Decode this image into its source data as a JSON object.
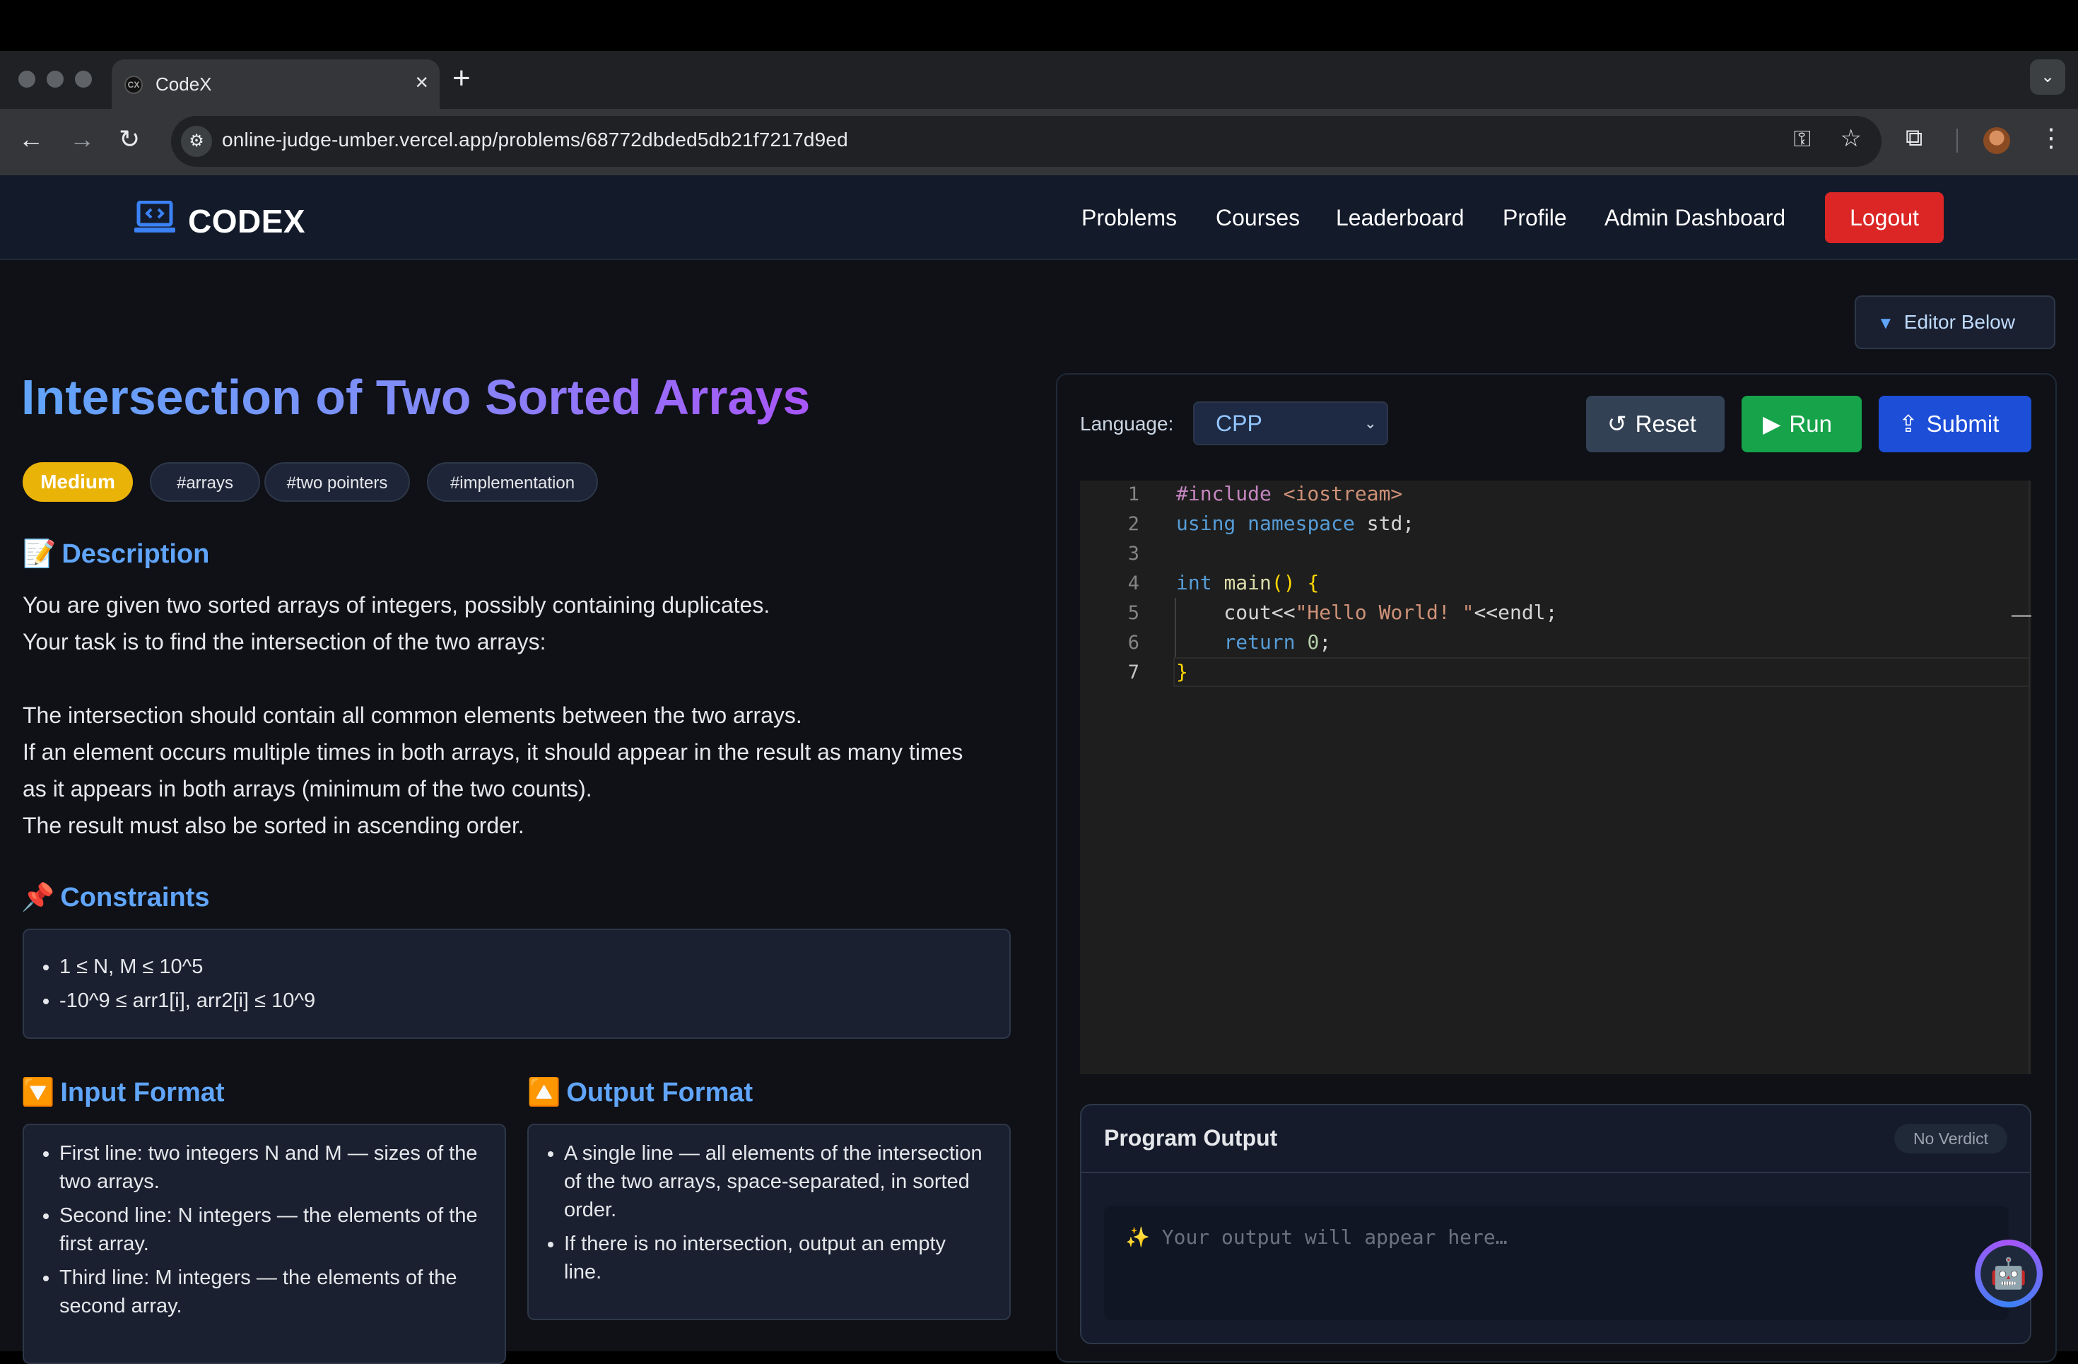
{
  "browser": {
    "tab_title": "CodeX",
    "tab_favicon": "CX",
    "new_tab": "+",
    "url": "online-judge-umber.vercel.app/problems/68772dbded5db21f7217d9ed",
    "icons": [
      "back-icon",
      "forward-icon",
      "reload-icon",
      "site-settings-icon",
      "password-key-icon",
      "bookmark-star-icon",
      "extensions-icon",
      "profile-avatar",
      "more-menu-icon"
    ]
  },
  "nav": {
    "brand": "CODEX",
    "links": [
      "Problems",
      "Courses",
      "Leaderboard",
      "Profile",
      "Admin Dashboard"
    ],
    "logout": "Logout"
  },
  "toggle": {
    "editor_below": "Editor Below"
  },
  "problem": {
    "title": "Intersection of Two Sorted Arrays",
    "difficulty": "Medium",
    "tags": [
      "#arrays",
      "#two pointers",
      "#implementation"
    ],
    "description_heading": "Description",
    "description_emoji": "📝",
    "description": [
      "You are given two sorted arrays of integers, possibly containing duplicates.",
      "Your task is to find the intersection of the two arrays:",
      "The intersection should contain all common elements between the two arrays.",
      "If an element occurs multiple times in both arrays, it should appear in the result as many times",
      "as it appears in both arrays (minimum of the two counts).",
      "The result must also be sorted in ascending order."
    ],
    "constraints_heading": "Constraints",
    "constraints_emoji": "📌",
    "constraints": [
      "1 ≤ N, M ≤ 10^5",
      "-10^9 ≤ arr1[i], arr2[i] ≤ 10^9"
    ],
    "input_heading": "Input Format",
    "input_emoji": "🔽",
    "input": [
      "First line: two integers N and M — sizes of the two arrays.",
      "Second line: N integers — the elements of the first array.",
      "Third line: M integers — the elements of the second array."
    ],
    "output_heading": "Output Format",
    "output_emoji": "🔼",
    "output": [
      "A single line — all elements of the intersection of the two arrays, space-separated, in sorted order.",
      "If there is no intersection, output an empty line."
    ]
  },
  "editor": {
    "language_label": "Language:",
    "language": "CPP",
    "reset": "Reset",
    "run": "Run",
    "submit": "Submit",
    "line_numbers": [
      "1",
      "2",
      "3",
      "4",
      "5",
      "6",
      "7"
    ],
    "code": [
      "#include <iostream>",
      "using namespace std;",
      "",
      "int main() {",
      "    cout<<\"Hello World! \"<<endl;",
      "    return 0;",
      "}"
    ]
  },
  "output": {
    "title": "Program Output",
    "verdict": "No Verdict",
    "placeholder_icon": "✨",
    "placeholder": "Your output will appear here…"
  },
  "colors": {
    "accent_blue": "#60a5fa",
    "difficulty_medium": "#eab308",
    "logout_red": "#dc2626",
    "run_green": "#16a34a",
    "submit_blue": "#1d4ed8"
  }
}
